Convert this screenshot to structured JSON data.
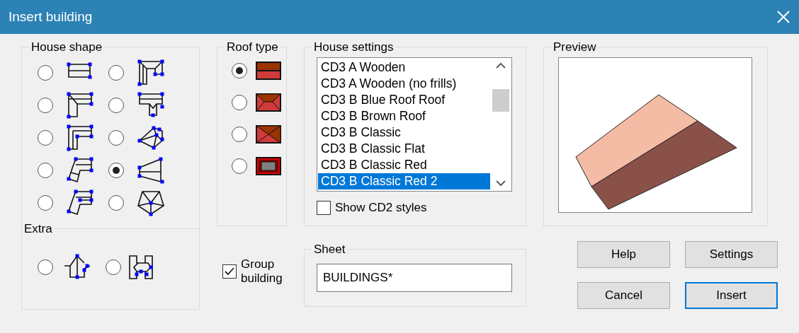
{
  "window": {
    "title": "Insert building"
  },
  "house_shape": {
    "title": "House shape",
    "options": [
      {
        "selected": false
      },
      {
        "selected": false
      },
      {
        "selected": false
      },
      {
        "selected": false
      },
      {
        "selected": false
      },
      {
        "selected": false
      },
      {
        "selected": false
      },
      {
        "selected": true
      },
      {
        "selected": false
      },
      {
        "selected": false
      }
    ],
    "extra": {
      "title": "Extra",
      "options": [
        {
          "selected": false
        },
        {
          "selected": false
        }
      ]
    }
  },
  "roof_type": {
    "title": "Roof type",
    "options": [
      {
        "selected": true
      },
      {
        "selected": false
      },
      {
        "selected": false
      },
      {
        "selected": false
      }
    ]
  },
  "group_building": {
    "label": "Group building",
    "checked": true
  },
  "house_settings": {
    "title": "House settings",
    "items": [
      {
        "label": "CD3 A Wooden",
        "selected": false
      },
      {
        "label": "CD3 A Wooden (no frills)",
        "selected": false
      },
      {
        "label": "CD3 B Blue Roof Roof",
        "selected": false
      },
      {
        "label": "CD3 B Brown Roof",
        "selected": false
      },
      {
        "label": "CD3 B Classic",
        "selected": false
      },
      {
        "label": "CD3 B Classic Flat",
        "selected": false
      },
      {
        "label": "CD3 B Classic Red",
        "selected": false
      },
      {
        "label": "CD3 B Classic Red 2",
        "selected": true
      }
    ],
    "show_cd2_styles": {
      "label": "Show CD2 styles",
      "checked": false
    }
  },
  "preview": {
    "title": "Preview"
  },
  "sheet": {
    "title": "Sheet",
    "value": "BUILDINGS*"
  },
  "buttons": [
    {
      "label": "Help",
      "default": false
    },
    {
      "label": "Settings",
      "default": false
    },
    {
      "label": "Cancel",
      "default": false
    },
    {
      "label": "Insert",
      "default": true
    }
  ]
}
